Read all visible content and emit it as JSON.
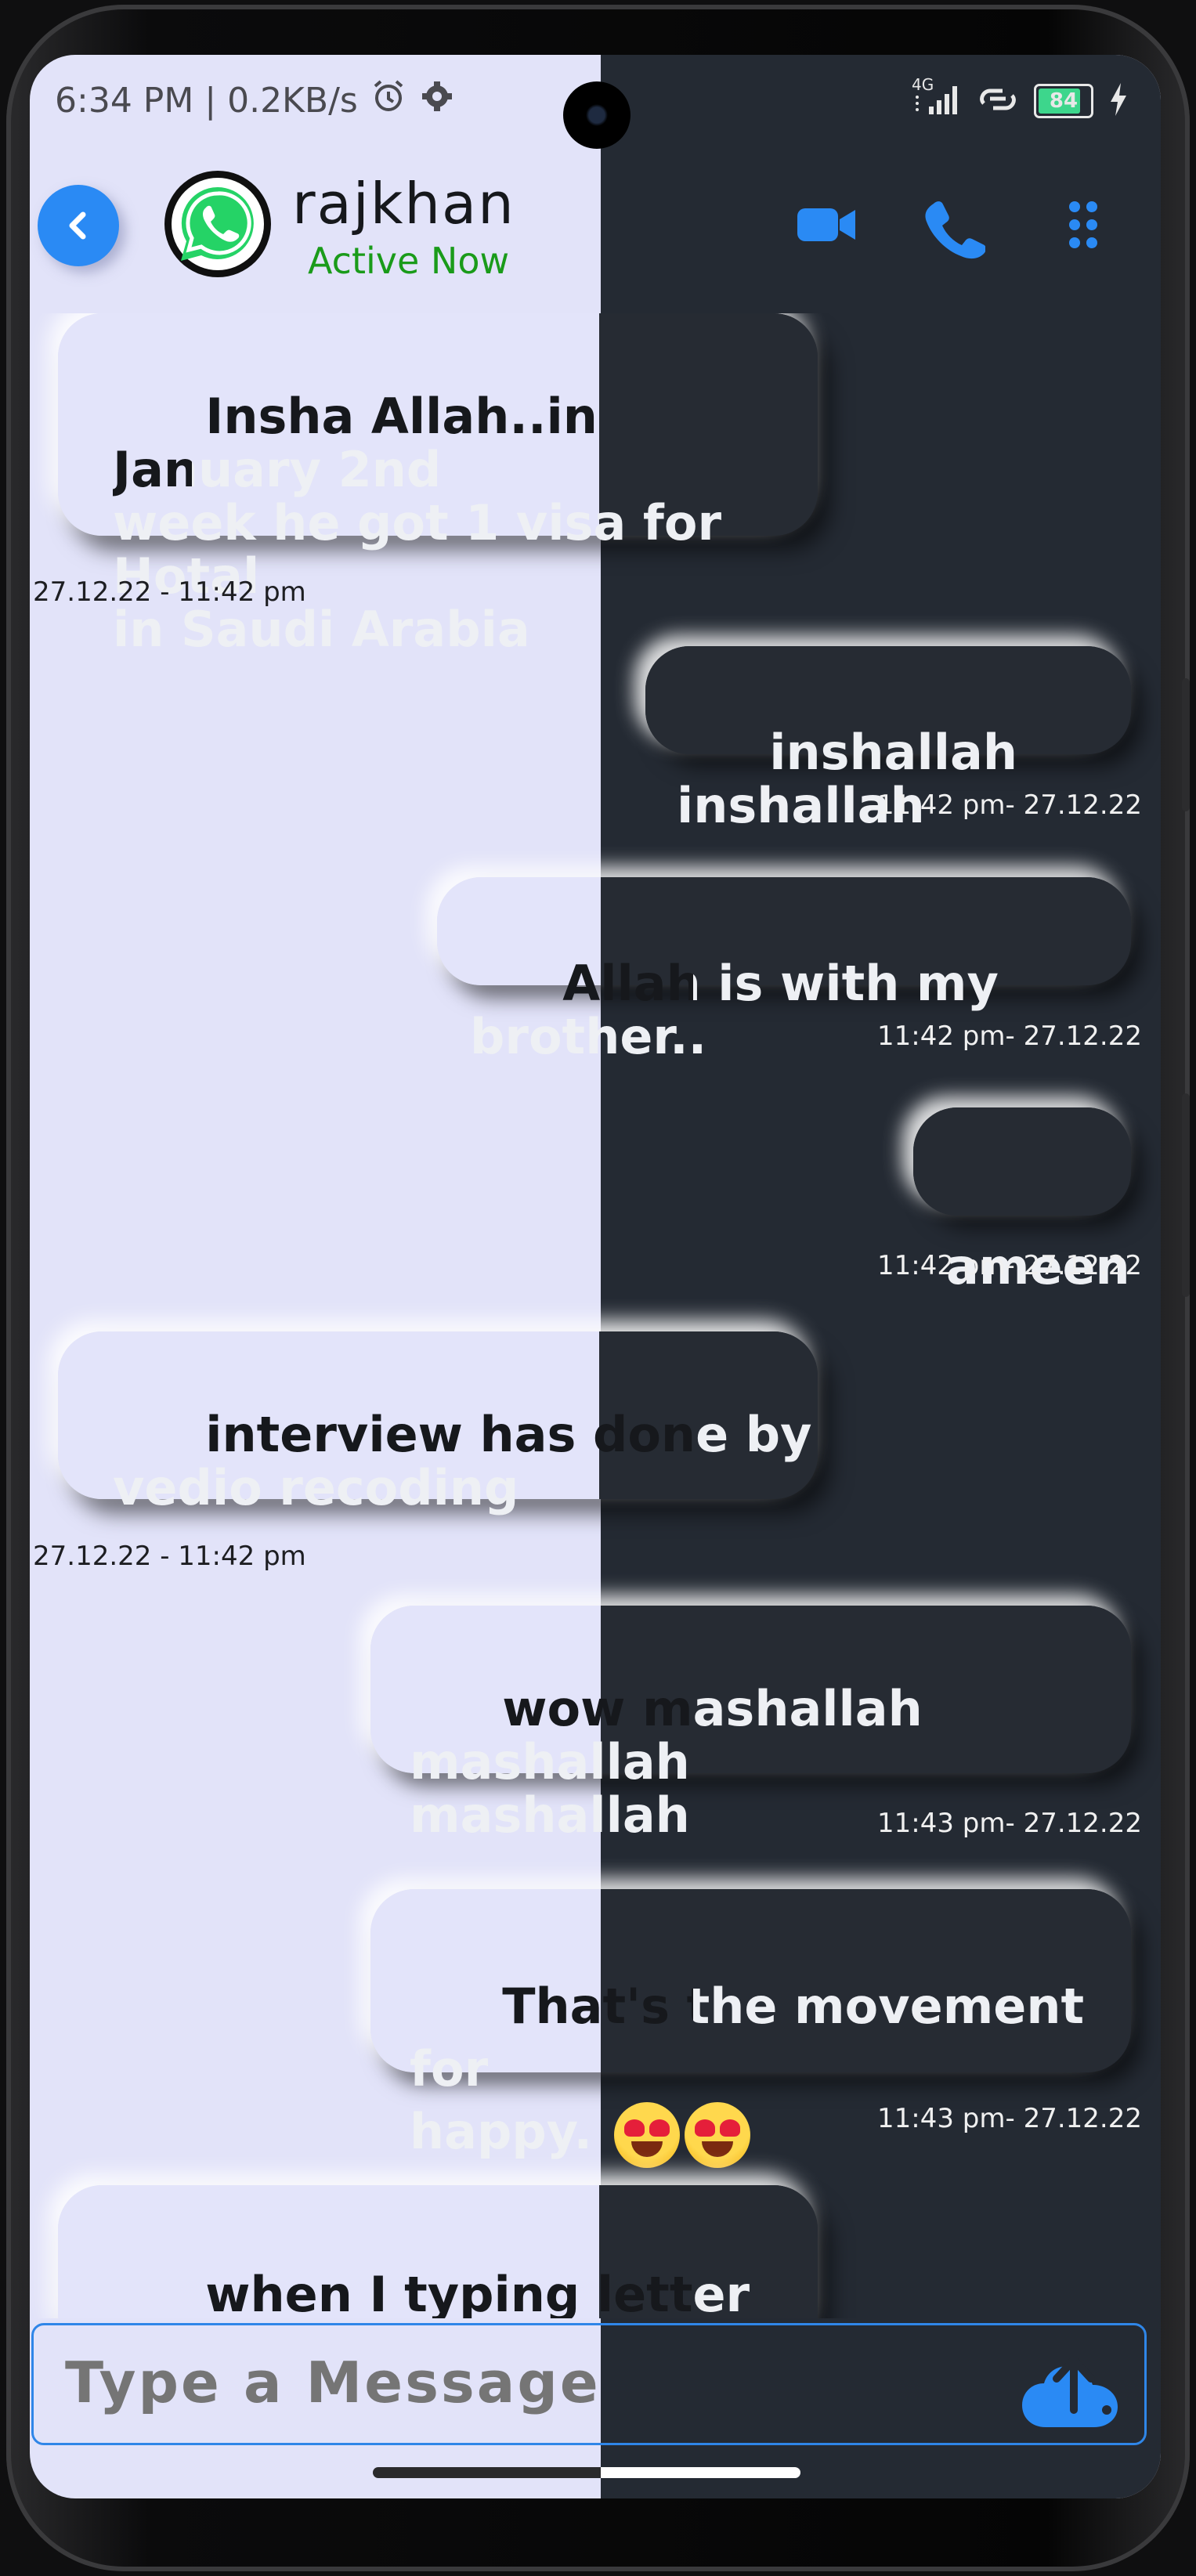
{
  "status_bar": {
    "time_speed": "6:34 PM | 0.2KB/s",
    "network": "4G",
    "battery": "84"
  },
  "header": {
    "contact_name": "rajkhan",
    "status": "Active Now"
  },
  "messages": [
    {
      "dir": "in",
      "text": "Insha Allah..in January 2nd\nweek he got 1 visa for Hotal\nin Saudi Arabia",
      "time": "27.12.22 - 11:42 pm"
    },
    {
      "dir": "out",
      "text": "inshallah inshallah",
      "time": "11:42 pm- 27.12.22"
    },
    {
      "dir": "out",
      "text": "Allah is with my brother..",
      "time": "11:42 pm- 27.12.22"
    },
    {
      "dir": "out",
      "text": "ameen",
      "time": "11:42 pm- 27.12.22"
    },
    {
      "dir": "in",
      "text": "interview has done by\nvedio recoding",
      "time": "27.12.22 - 11:42 pm"
    },
    {
      "dir": "out",
      "text": "wow mashallah mashallah\nmashallah",
      "time": "11:43 pm- 27.12.22"
    },
    {
      "dir": "out",
      "text": "That's the movement for\nhappy. ",
      "emoji": "heart-eyes-emoji",
      "time": "11:43 pm- 27.12.22"
    },
    {
      "dir": "in",
      "text": "when I typing letter are\ncutting loking why",
      "time": ""
    }
  ],
  "composer": {
    "placeholder": "Type a Message"
  },
  "colors": {
    "accent": "#2a8af4",
    "active_green": "#1a9b1a",
    "light_bg": "#e2e3f9",
    "dark_bg": "#242a33"
  },
  "icons": {
    "back": "chevron-left-icon",
    "avatar": "whatsapp-icon",
    "video": "video-camera-icon",
    "phone": "phone-icon",
    "menu": "dots-grid-icon",
    "send": "cloud-upload-icon",
    "alarm": "alarm-icon",
    "settings": "gear-icon",
    "signal": "signal-icon",
    "hotspot": "link-icon",
    "charging": "bolt-icon"
  }
}
